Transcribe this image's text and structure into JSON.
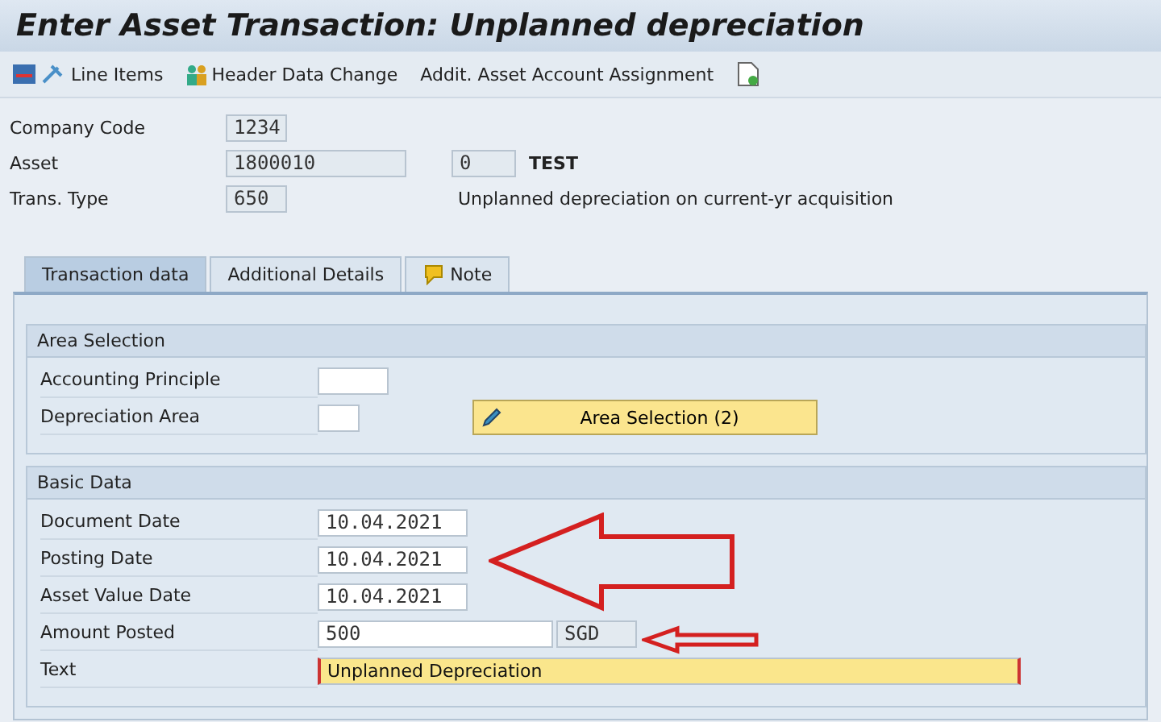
{
  "window": {
    "title": "Enter Asset Transaction: Unplanned depreciation"
  },
  "toolbar": [
    {
      "label": "Line Items"
    },
    {
      "label": "Header Data Change"
    },
    {
      "label": "Addit. Asset Account Assignment"
    }
  ],
  "header": [
    {
      "label": "Company Code",
      "field": {
        "value": "1234"
      }
    },
    {
      "label": "Asset",
      "field": {
        "value": "1800010"
      },
      "sub_field": {
        "value": "0"
      },
      "description": "TEST"
    },
    {
      "label": "Trans. Type",
      "field": {
        "value": "650"
      },
      "description": "Unplanned depreciation on current-yr acquisition"
    }
  ],
  "tabs": [
    {
      "label": "Transaction data",
      "selected": true
    },
    {
      "label": "Additional Details",
      "selected": false
    },
    {
      "label": "Note",
      "selected": false
    }
  ],
  "area_selection": {
    "title": "Area Selection",
    "rows": [
      {
        "label": "Accounting Principle",
        "kind": "input"
      },
      {
        "label": "Depreciation Area",
        "kind": "input"
      }
    ],
    "button": "Area Selection (2)"
  },
  "basic_data": {
    "title": "Basic Data",
    "rows": [
      {
        "label": "Document Date",
        "kind": "input",
        "value": "10.04.2021"
      },
      {
        "label": "Posting Date",
        "kind": "input",
        "value": "10.04.2021"
      },
      {
        "label": "Asset Value Date",
        "kind": "input",
        "value": "10.04.2021"
      },
      {
        "label": "Amount Posted",
        "kind": "input",
        "value": "500",
        "unit": "SGD"
      },
      {
        "label": "Text",
        "kind": "focused",
        "value": "Unplanned Depreciation"
      }
    ]
  }
}
